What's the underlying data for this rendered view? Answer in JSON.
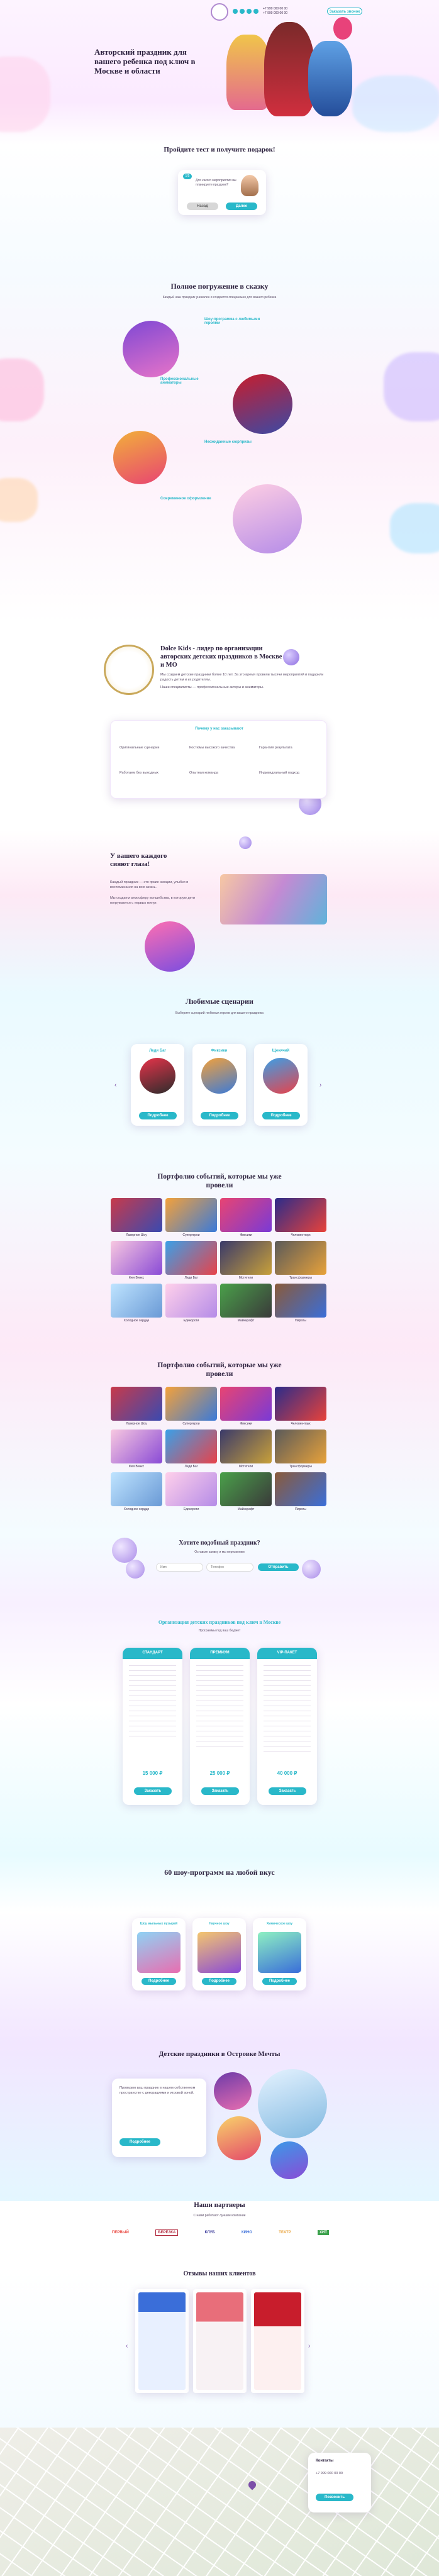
{
  "header": {
    "phone1": "+7 999 000 00 00",
    "phone2": "+7 999 000 00 00",
    "cta": "Заказать звонок"
  },
  "hero": {
    "title": "Авторский праздник для вашего ребенка под ключ в Москве и области"
  },
  "quiz": {
    "title": "Пройдите тест и получите подарок!",
    "step": "1/5",
    "question": "Для какого мероприятия вы планируете праздник?",
    "prev": "Назад",
    "next": "Далее"
  },
  "immersion": {
    "title": "Полное погружение в сказку",
    "subtitle": "Каждый наш праздник уникален и создается специально для вашего ребенка",
    "features": [
      {
        "label": "Шоу-программа с любимыми героями"
      },
      {
        "label": "Профессиональные аниматоры"
      },
      {
        "label": "Неожиданные сюрпризы"
      },
      {
        "label": "Современное оформление"
      }
    ]
  },
  "about": {
    "title": "Dolce Kids - лидер по организации авторских детских праздников в Москве и МО",
    "text1": "Мы создаем детские праздники более 10 лет. За это время провели тысячи мероприятий и подарили радость детям и их родителям.",
    "text2": "Наши специалисты — профессиональные актеры и аниматоры.",
    "why_title": "Почему у нас заказывают",
    "why": [
      "Оригинальные сценарии",
      "Костюмы высокого качества",
      "Гарантия результата",
      "Работаем без выходных",
      "Опытная команда",
      "Индивидуальный подход"
    ]
  },
  "eyes": {
    "title": "У вашего каждого сияют глаза!",
    "text": "Каждый праздник — это яркие эмоции, улыбки и воспоминания на всю жизнь.",
    "text2": "Мы создаем атмосферу волшебства, в которую дети погружаются с первых минут."
  },
  "scenarios": {
    "title": "Любимые сценарии",
    "subtitle": "Выберите сценарий любимых героев для вашего праздника",
    "items": [
      {
        "name": "Леди Баг",
        "cta": "Подробнее"
      },
      {
        "name": "Фиксики",
        "cta": "Подробнее"
      },
      {
        "name": "Щенячий",
        "cta": "Подробнее"
      }
    ]
  },
  "portfolio1": {
    "title": "Портфолио событий, которые мы уже провели",
    "captions": [
      "Лазерное Шоу",
      "Супергерои",
      "Фиксики",
      "Человек-паук",
      "Фея Винкс",
      "Леди Баг",
      "Мстители",
      "Трансформеры",
      "Холодное сердце",
      "Единороги",
      "Майнкрафт",
      "Пираты"
    ]
  },
  "portfolio2": {
    "title": "Портфолио событий, которые мы уже провели",
    "captions": [
      "Лазерное Шоу",
      "Супергерои",
      "Фиксики",
      "Человек-паук",
      "Фея Винкс",
      "Леди Баг",
      "Мстители",
      "Трансформеры",
      "Холодное сердце",
      "Единороги",
      "Майнкрафт",
      "Пираты"
    ]
  },
  "form": {
    "title": "Хотите подобный праздник?",
    "subtitle": "Оставьте заявку и мы перезвоним",
    "name_placeholder": "Имя",
    "phone_placeholder": "Телефон",
    "cta": "Отправить"
  },
  "pricing": {
    "title": "Организация детских праздников под ключ в Москве",
    "subtitle": "Программы под ваш бюджет",
    "plans": [
      {
        "name": "СТАНДАРТ",
        "price": "15 000 ₽",
        "cta": "Заказать"
      },
      {
        "name": "ПРЕМИУМ",
        "price": "25 000 ₽",
        "cta": "Заказать"
      },
      {
        "name": "VIP-ПАКЕТ",
        "price": "40 000 ₽",
        "cta": "Заказать"
      }
    ]
  },
  "programs": {
    "title": "60 шоу-программ на любой вкус",
    "items": [
      {
        "name": "Шоу мыльных пузырей",
        "cta": "Подробнее"
      },
      {
        "name": "Научное шоу",
        "cta": "Подробнее"
      },
      {
        "name": "Химическое шоу",
        "cta": "Подробнее"
      }
    ]
  },
  "dream": {
    "title": "Детские праздники в Островке Мечты",
    "text": "Проведем ваш праздник в нашем собственном пространстве с декорациями и игровой зоной.",
    "cta": "Подробнее"
  },
  "partners": {
    "title": "Наши партнеры",
    "subtitle": "С нами работают лучшие компании",
    "logos": [
      "ПЕРВЫЙ",
      "БЕРЁЗКА",
      "КЛУБ",
      "КИНО",
      "ТЕАТР",
      "ХИТ"
    ]
  },
  "reviews": {
    "title": "Отзывы наших клиентов"
  },
  "contacts": {
    "title": "Контакты",
    "phone": "+7 999 000 00 00",
    "cta": "Позвонить"
  },
  "colors": {
    "accent": "#29b8c9",
    "purple": "#7c4fa8",
    "pink": "#f4a6d2"
  }
}
